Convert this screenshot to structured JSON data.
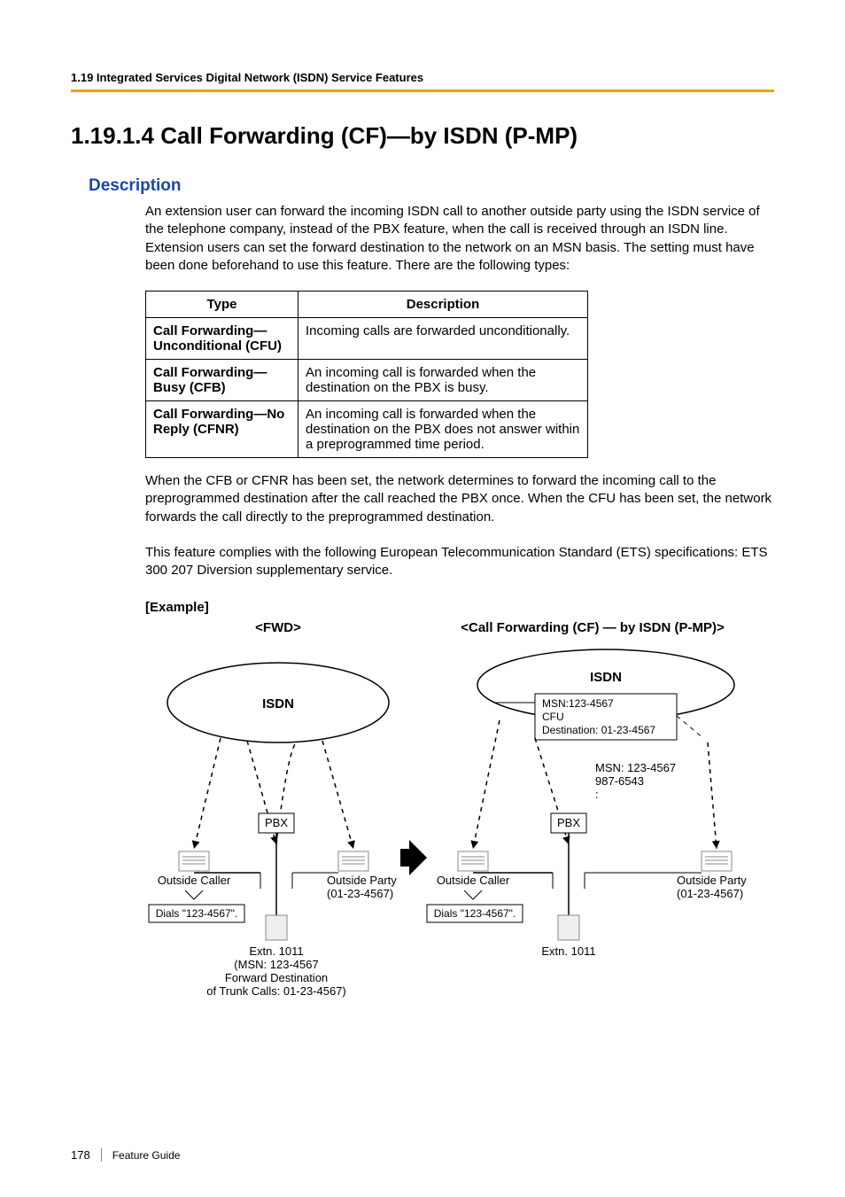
{
  "header": "1.19 Integrated Services Digital Network (ISDN) Service Features",
  "title": "1.19.1.4   Call Forwarding (CF)—by ISDN (P-MP)",
  "description_heading": "Description",
  "paragraphs": {
    "p1": "An extension user can forward the incoming ISDN call to another outside party using the ISDN service of the telephone company, instead of the PBX feature, when the call is received through an ISDN line.",
    "p2": "Extension users can set the forward destination to the network on an MSN basis. The setting must have been done beforehand to use this feature. There are the following types:",
    "p3": "When the CFB or CFNR has been set, the network determines to forward the incoming call to the preprogrammed destination after the call reached the PBX once. When the CFU has been set, the network forwards the call directly to the preprogrammed destination.",
    "p4": "This feature complies with the following European Telecommunication Standard (ETS) specifications: ETS 300 207 Diversion supplementary service."
  },
  "table": {
    "head_type": "Type",
    "head_desc": "Description",
    "rows": [
      {
        "type": "Call Forwarding—Unconditional (CFU)",
        "desc": "Incoming calls are forwarded unconditionally."
      },
      {
        "type": "Call Forwarding—Busy (CFB)",
        "desc": "An incoming call is forwarded when the destination on the PBX is busy."
      },
      {
        "type": "Call Forwarding—No Reply (CFNR)",
        "desc": "An incoming call is forwarded when the destination on the PBX does not answer within a preprogrammed time period."
      }
    ]
  },
  "example_label": "[Example]",
  "diagram": {
    "left_title": "<FWD>",
    "right_title": "<Call Forwarding (CF) — by ISDN (P-MP)>",
    "left": {
      "cloud": "ISDN",
      "pbx": "PBX",
      "caller": "Outside Caller",
      "dials": "Dials \"123-4567\".",
      "party": "Outside Party",
      "party_num": "(01-23-4567)",
      "extn": "Extn. 1011",
      "note1": "(MSN: 123-4567",
      "note2": " Forward Destination",
      "note3": " of Trunk Calls: 01-23-4567)"
    },
    "right": {
      "cloud": "ISDN",
      "msn1": "MSN:123-4567",
      "msn2": "CFU",
      "msn3": "Destination: 01-23-4567",
      "m1": "MSN: 123-4567",
      "m2": "       987-6543",
      "m3": "         :",
      "pbx": "PBX",
      "caller": "Outside Caller",
      "dials": "Dials \"123-4567\".",
      "party": "Outside Party",
      "party_num": "(01-23-4567)",
      "extn": "Extn. 1011"
    }
  },
  "footer": {
    "page": "178",
    "guide": "Feature Guide"
  }
}
